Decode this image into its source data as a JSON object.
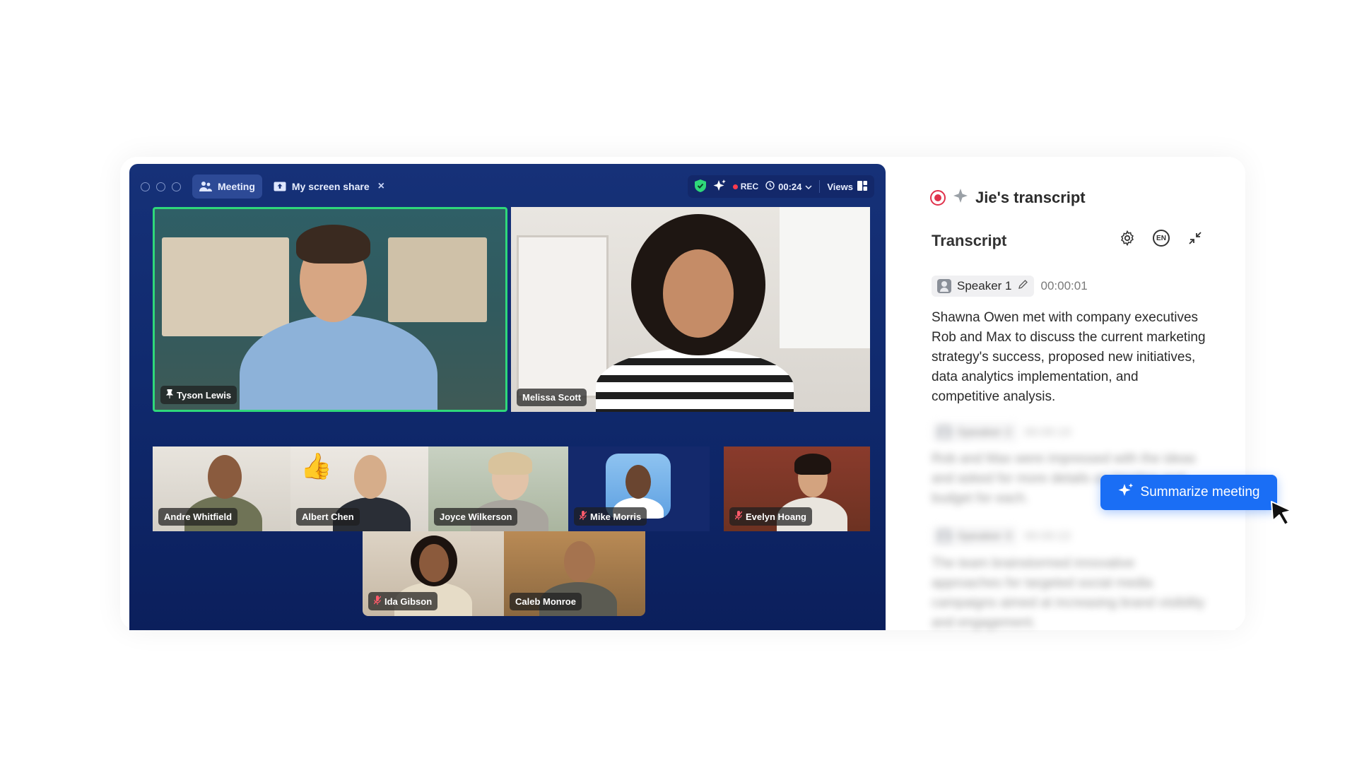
{
  "meeting": {
    "tabs": [
      {
        "label": "Meeting",
        "icon": "people-icon",
        "active": true
      },
      {
        "label": "My screen share",
        "icon": "screen-share-icon",
        "active": false
      }
    ],
    "toolbar": {
      "rec_label": "REC",
      "timer": "00:24",
      "views_label": "Views"
    },
    "participants_main": [
      {
        "name": "Tyson Lewis",
        "pinned": true,
        "active_speaker": true
      },
      {
        "name": "Melissa Scott",
        "pinned": false,
        "active_speaker": false
      }
    ],
    "participants_row": [
      {
        "name": "Andre Whitfield",
        "muted": false
      },
      {
        "name": "Albert Chen",
        "muted": false,
        "reaction": "👍"
      },
      {
        "name": "Joyce Wilkerson",
        "muted": false
      },
      {
        "name": "Mike Morris",
        "muted": true
      },
      {
        "name": "Evelyn Hoang",
        "muted": true
      }
    ],
    "participants_bottom": [
      {
        "name": "Ida Gibson",
        "muted": true
      },
      {
        "name": "Caleb Monroe",
        "muted": false
      }
    ]
  },
  "panel": {
    "title": "Jie's transcript",
    "section_title": "Transcript",
    "language_badge": "EN",
    "entries": [
      {
        "speaker": "Speaker 1",
        "timestamp": "00:00:01",
        "text": "Shawna Owen met with company executives Rob and Max to discuss the current marketing strategy's success, proposed new initiatives, data analytics implementation, and competitive analysis."
      },
      {
        "speaker": "Speaker 2",
        "timestamp": "00:00:10",
        "text": "Rob and Max were impressed with the ideas and asked for more details on timeline and budget for each."
      },
      {
        "speaker": "Speaker 3",
        "timestamp": "00:00:22",
        "text": "The team brainstormed innovative approaches for targeted social media campaigns aimed at increasing brand visibility and engagement."
      }
    ],
    "summarize_label": "Summarize meeting"
  },
  "colors": {
    "meeting_bg": "#102a6e",
    "active_border": "#2fd87a",
    "accent": "#1a6ef5",
    "rec": "#e0314b"
  }
}
